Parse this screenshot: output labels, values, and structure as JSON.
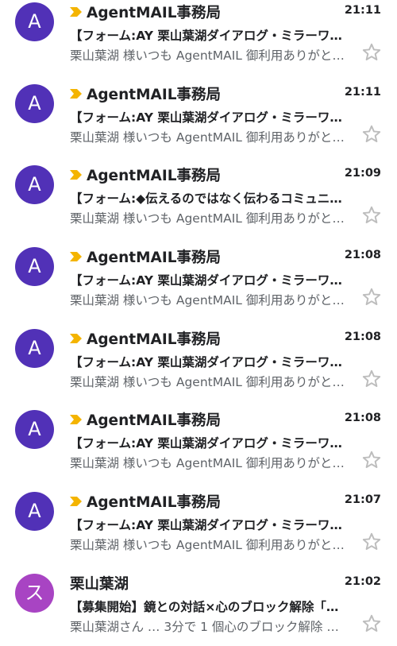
{
  "colors": {
    "avatar_primary": "#5131b7",
    "avatar_secondary": "#a844c3",
    "importance_marker": "#f4b400",
    "star_outline": "#bdbdbd"
  },
  "messages": [
    {
      "avatar_letter": "A",
      "avatar_color": "#5131b7",
      "important": true,
      "sender": "AgentMAIL事務局",
      "time": "21:11",
      "subject": "【フォーム:AY 栗山葉湖ダイアログ・ミラーワ…",
      "snippet": "栗山葉湖 様いつも AgentMAIL 御利用ありがと…",
      "star_icon": "star-outline-icon"
    },
    {
      "avatar_letter": "A",
      "avatar_color": "#5131b7",
      "important": true,
      "sender": "AgentMAIL事務局",
      "time": "21:11",
      "subject": "【フォーム:AY 栗山葉湖ダイアログ・ミラーワ…",
      "snippet": "栗山葉湖 様いつも AgentMAIL 御利用ありがと…",
      "star_icon": "star-outline-icon"
    },
    {
      "avatar_letter": "A",
      "avatar_color": "#5131b7",
      "important": true,
      "sender": "AgentMAIL事務局",
      "time": "21:09",
      "subject": "【フォーム:◆伝えるのではなく伝わるコミュニ…",
      "snippet": "栗山葉湖 様いつも AgentMAIL 御利用ありがと…",
      "star_icon": "star-outline-icon"
    },
    {
      "avatar_letter": "A",
      "avatar_color": "#5131b7",
      "important": true,
      "sender": "AgentMAIL事務局",
      "time": "21:08",
      "subject": "【フォーム:AY 栗山葉湖ダイアログ・ミラーワ…",
      "snippet": "栗山葉湖 様いつも AgentMAIL 御利用ありがと…",
      "star_icon": "star-outline-icon"
    },
    {
      "avatar_letter": "A",
      "avatar_color": "#5131b7",
      "important": true,
      "sender": "AgentMAIL事務局",
      "time": "21:08",
      "subject": "【フォーム:AY 栗山葉湖ダイアログ・ミラーワ…",
      "snippet": "栗山葉湖 様いつも AgentMAIL 御利用ありがと…",
      "star_icon": "star-outline-icon"
    },
    {
      "avatar_letter": "A",
      "avatar_color": "#5131b7",
      "important": true,
      "sender": "AgentMAIL事務局",
      "time": "21:08",
      "subject": "【フォーム:AY 栗山葉湖ダイアログ・ミラーワ…",
      "snippet": "栗山葉湖 様いつも AgentMAIL 御利用ありがと…",
      "star_icon": "star-outline-icon"
    },
    {
      "avatar_letter": "A",
      "avatar_color": "#5131b7",
      "important": true,
      "sender": "AgentMAIL事務局",
      "time": "21:07",
      "subject": "【フォーム:AY 栗山葉湖ダイアログ・ミラーワ…",
      "snippet": "栗山葉湖 様いつも AgentMAIL 御利用ありがと…",
      "star_icon": "star-outline-icon"
    },
    {
      "avatar_letter": "ス",
      "avatar_color": "#a844c3",
      "important": false,
      "sender": "栗山葉湖",
      "time": "21:02",
      "subject": "【募集開始】鏡との対話×心のブロック解除「…",
      "snippet": "栗山葉湖さん … 3分で 1 個心のブロック解除 マ…",
      "star_icon": "star-outline-icon"
    }
  ]
}
